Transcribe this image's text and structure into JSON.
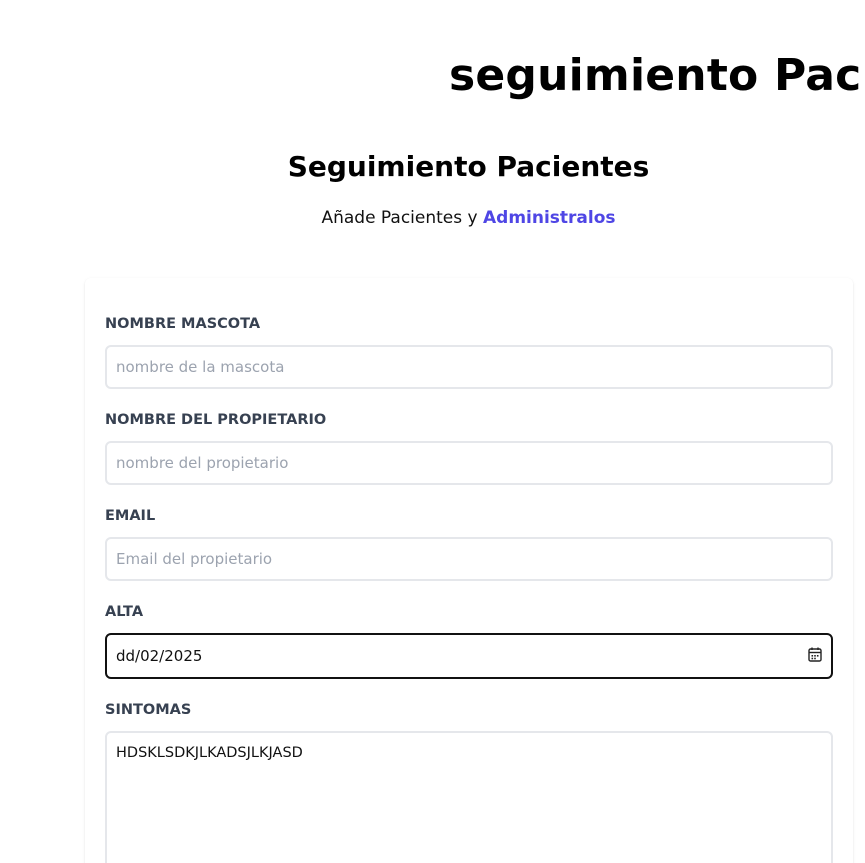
{
  "header": {
    "title": "seguimiento Pacientes"
  },
  "form_header": {
    "title": "Seguimiento Pacientes",
    "subtitle_prefix": "Añade Pacientes y ",
    "subtitle_accent": "Administralos"
  },
  "form": {
    "mascota": {
      "label": "NOMBRE MASCOTA",
      "placeholder": "nombre de la mascota",
      "value": ""
    },
    "propietario": {
      "label": "NOMBRE DEL PROPIETARIO",
      "placeholder": "nombre del propietario",
      "value": ""
    },
    "email": {
      "label": "EMAIL",
      "placeholder": "Email del propietario",
      "value": ""
    },
    "alta": {
      "label": "ALTA",
      "value": "dd/02/2025"
    },
    "sintomas": {
      "label": "SINTOMAS",
      "value": "HDSKLSDKJLKADSJLKJASD"
    }
  },
  "colors": {
    "accent": "#4f46e5",
    "label": "#374151",
    "input_border": "#e5e7eb",
    "focused_border": "#111111",
    "placeholder": "#9ca3af"
  },
  "icons": {
    "date_picker": "calendar-icon"
  }
}
